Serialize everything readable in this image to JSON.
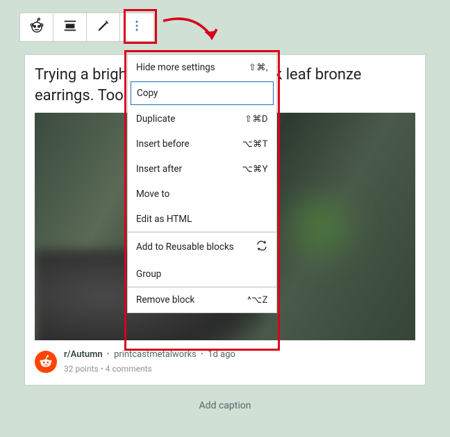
{
  "toolbar": {
    "reddit_icon": "reddit-icon",
    "align_icon": "align-center-icon",
    "edit_icon": "pencil-icon",
    "more_icon": "more-vertical-icon"
  },
  "post": {
    "title": "Trying a brighter patina on these oak leaf bronze earrings. Too much?",
    "subreddit": "r/Autumn",
    "author": "printcastmetalworks",
    "age": "1d ago",
    "points": "32 points",
    "comments": "4 comments"
  },
  "menu": {
    "items": [
      {
        "label": "Hide more settings",
        "shortcut": "⇧⌘,"
      },
      {
        "label": "Copy",
        "shortcut": ""
      },
      {
        "label": "Duplicate",
        "shortcut": "⇧⌘D"
      },
      {
        "label": "Insert before",
        "shortcut": "⌥⌘T"
      },
      {
        "label": "Insert after",
        "shortcut": "⌥⌘Y"
      },
      {
        "label": "Move to",
        "shortcut": ""
      },
      {
        "label": "Edit as HTML",
        "shortcut": ""
      }
    ],
    "group2": [
      {
        "label": "Add to Reusable blocks"
      },
      {
        "label": "Group"
      }
    ],
    "remove": {
      "label": "Remove block",
      "shortcut": "^⌥Z"
    }
  },
  "caption_placeholder": "Add caption"
}
